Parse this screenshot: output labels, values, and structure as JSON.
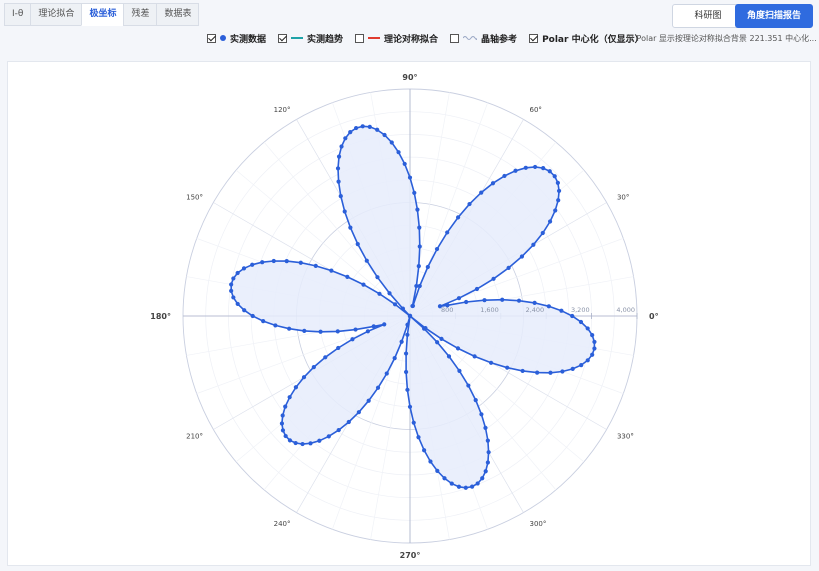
{
  "tabs": [
    {
      "label": "I-θ",
      "active": false
    },
    {
      "label": "理论拟合",
      "active": false
    },
    {
      "label": "极坐标",
      "active": true
    },
    {
      "label": "残差",
      "active": false
    },
    {
      "label": "数据表",
      "active": false
    }
  ],
  "buttons": {
    "research_figure": "科研图",
    "scan_report": "角度扫描报告"
  },
  "legend": [
    {
      "label": "实测数据",
      "checked": true,
      "swatch": "dot",
      "color": "#2b5fd9"
    },
    {
      "label": "实测趋势",
      "checked": true,
      "swatch": "line",
      "color": "#1fa3a8"
    },
    {
      "label": "理论对称拟合",
      "checked": false,
      "swatch": "line",
      "color": "#e03b2f"
    },
    {
      "label": "晶轴参考",
      "checked": false,
      "swatch": "wave",
      "color": "#9aa7c4"
    },
    {
      "label": "Polar 中心化（仅显示）",
      "checked": true,
      "swatch": "none",
      "color": ""
    }
  ],
  "note": "仅 Polar 显示按理论对称拟合背景 221.351 中心化...",
  "colors": {
    "accent": "#2f6bdf",
    "series": "#2b5fd9",
    "fill": "#e6ecfb",
    "grid": "#c9cfe0"
  },
  "chart_data": {
    "type": "polar",
    "angle_ticks_deg": [
      0,
      30,
      60,
      90,
      120,
      150,
      180,
      210,
      240,
      270,
      300,
      330
    ],
    "angle_tick_labels": [
      "0°",
      "30°",
      "60°",
      "90°",
      "120°",
      "150°",
      "180°",
      "210°",
      "240°",
      "270°",
      "300°",
      "330°"
    ],
    "radial_ticks": [
      0,
      800,
      1600,
      2400,
      3200,
      4000
    ],
    "radial_tick_labels": [
      "",
      "800",
      "1,600",
      "2,400",
      "3,200",
      "4,000"
    ],
    "r_range": [
      0,
      4000
    ],
    "series": [
      {
        "name": "实测数据",
        "shape": "rose",
        "petals": 6,
        "peak_angles_deg": [
          350,
          45,
          105,
          170,
          225,
          290
        ],
        "peak_values": [
          3300,
          3550,
          3450,
          3200,
          3050,
          3200
        ],
        "sample_step_deg": 2
      }
    ]
  }
}
